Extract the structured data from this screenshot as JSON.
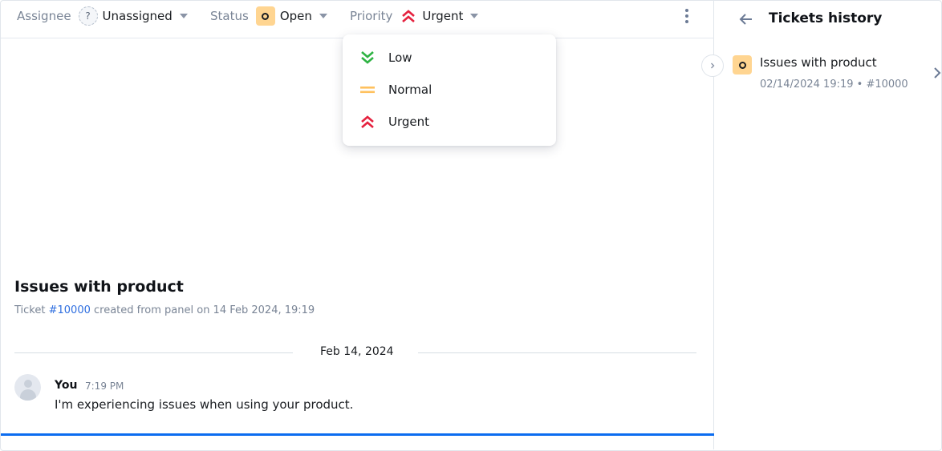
{
  "toolbar": {
    "assignee_label": "Assignee",
    "assignee_icon": "question-mark-icon",
    "assignee_value": "Unassigned",
    "status_label": "Status",
    "status_icon": "open-status-icon",
    "status_value": "Open",
    "priority_label": "Priority",
    "priority_icon": "urgent-double-chevron-up-icon",
    "priority_value": "Urgent",
    "more_icon": "kebab-menu-icon"
  },
  "priority_dropdown": {
    "items": [
      {
        "label": "Low",
        "icon": "double-chevron-down-icon",
        "color": "#2fb344"
      },
      {
        "label": "Normal",
        "icon": "equals-icon",
        "color": "#ffc15e"
      },
      {
        "label": "Urgent",
        "icon": "double-chevron-up-icon",
        "color": "#e5223f"
      }
    ]
  },
  "ticket": {
    "title": "Issues with product",
    "meta_prefix": "Ticket",
    "meta_link": "#10000",
    "meta_suffix": "created from panel on 14 Feb 2024, 19:19"
  },
  "conversation": {
    "date_separator": "Feb 14, 2024",
    "messages": [
      {
        "author": "You",
        "time": "7:19 PM",
        "text": "I'm experiencing issues when using your product."
      }
    ]
  },
  "side_panel": {
    "title": "Tickets history",
    "back_icon": "arrow-left-icon",
    "collapse_icon": "chevron-right-icon",
    "items": [
      {
        "title": "Issues with product",
        "meta": "02/14/2024 19:19 • #10000",
        "status": "Open"
      }
    ]
  },
  "colors": {
    "accent": "#0b6cf0",
    "link": "#2f6fe0",
    "status_open_bg": "#ffd591",
    "urgent": "#e5223f",
    "low": "#2fb344",
    "normal": "#ffc15e"
  }
}
